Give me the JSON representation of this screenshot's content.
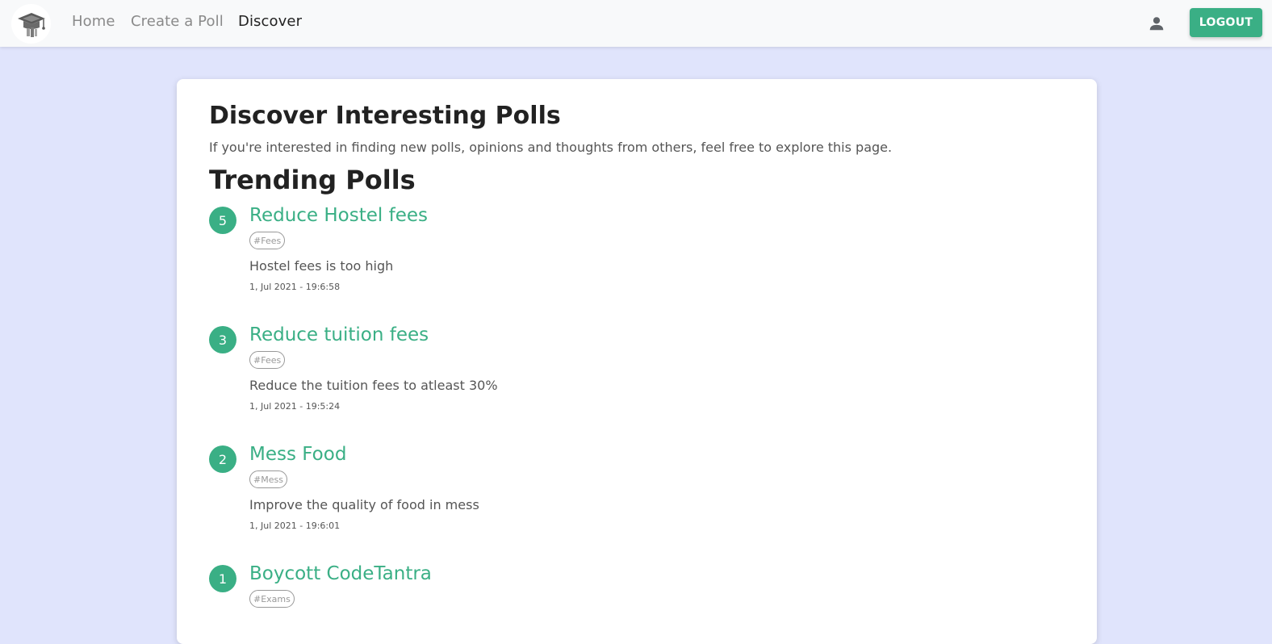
{
  "navbar": {
    "links": [
      "Home",
      "Create a Poll",
      "Discover"
    ],
    "active_link": "Discover",
    "logout_label": "LOGOUT"
  },
  "page": {
    "title": "Discover Interesting Polls",
    "description": "If you're interested in finding new polls, opinions and thoughts from others, feel free to explore this page.",
    "section_title": "Trending Polls"
  },
  "polls": [
    {
      "count": "5",
      "title": "Reduce Hostel fees",
      "tag": "#Fees",
      "description": "Hostel fees is too high",
      "date": "1, Jul 2021 - 19:6:58"
    },
    {
      "count": "3",
      "title": "Reduce tuition fees",
      "tag": "#Fees",
      "description": "Reduce the tuition fees to atleast 30%",
      "date": "1, Jul 2021 - 19:5:24"
    },
    {
      "count": "2",
      "title": "Mess Food",
      "tag": "#Mess",
      "description": "Improve the quality of food in mess",
      "date": "1, Jul 2021 - 19:6:01"
    },
    {
      "count": "1",
      "title": "Boycott CodeTantra",
      "tag": "#Exams",
      "description": "",
      "date": ""
    }
  ],
  "colors": {
    "accent": "#3aaf85",
    "page_background": "#e0e4fc",
    "navbar_background": "#f8f9fa"
  },
  "icons": [
    "graduation-cap-logo-icon",
    "user-icon"
  ]
}
